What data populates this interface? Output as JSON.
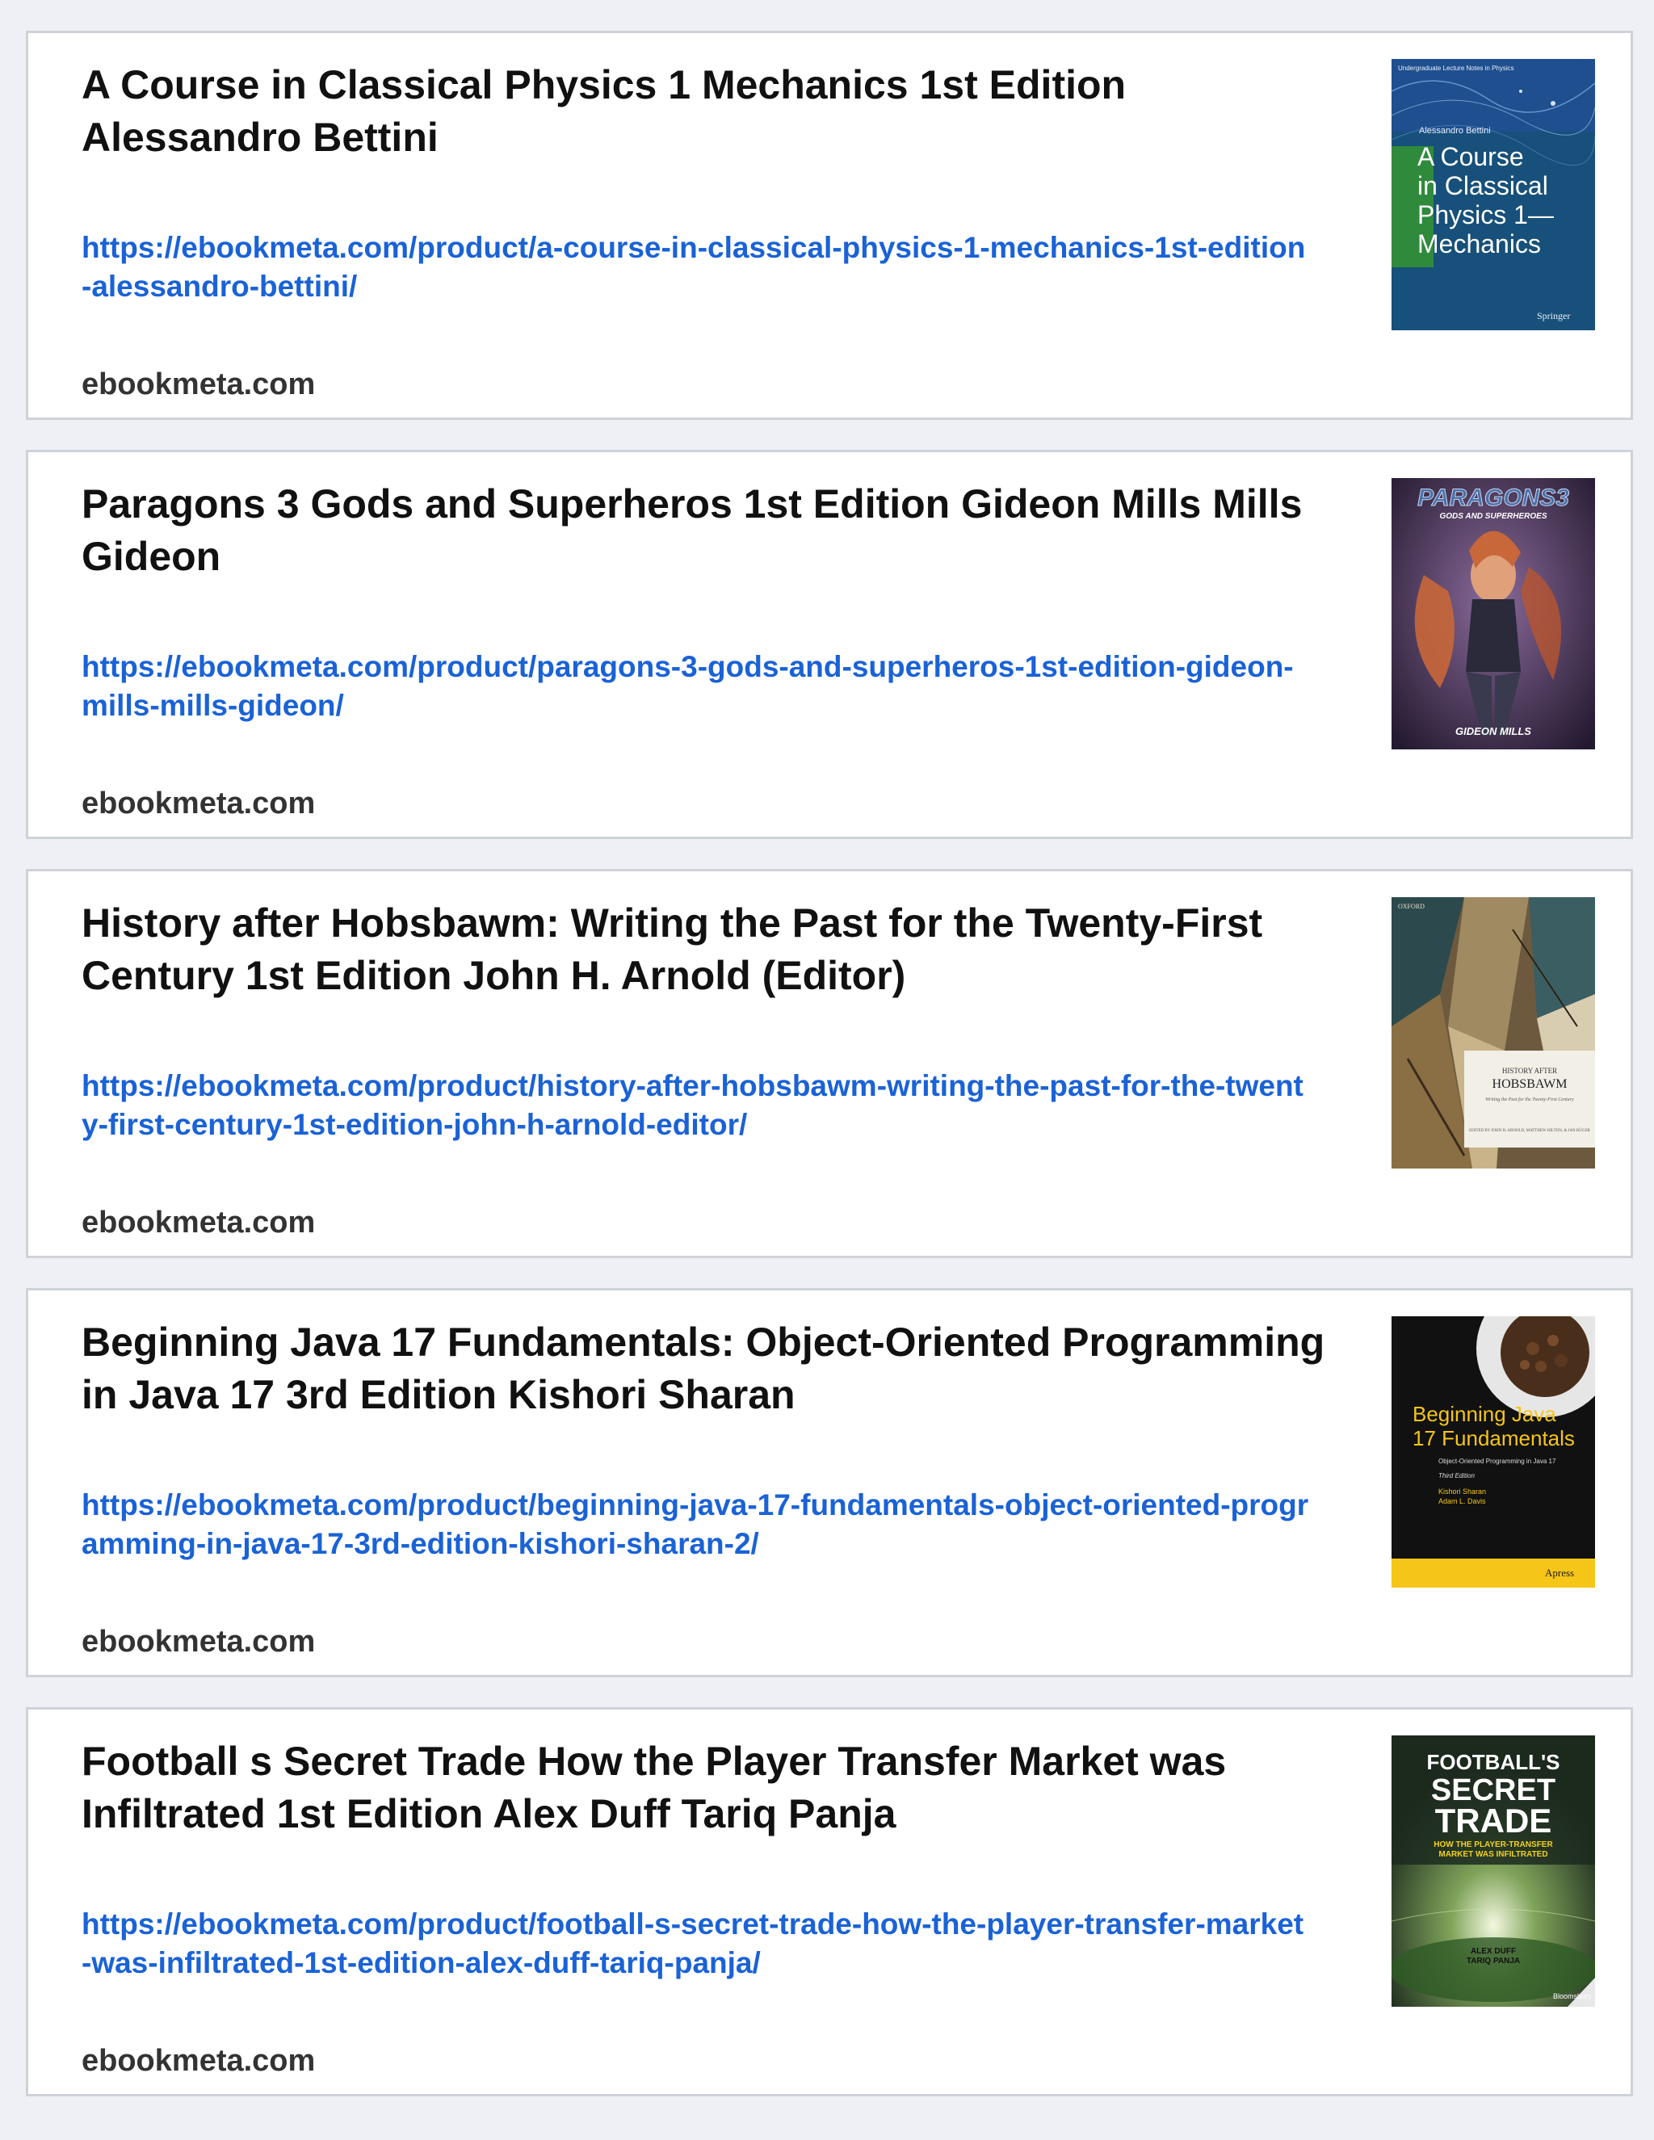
{
  "results": [
    {
      "title": "A Course in Classical Physics 1 Mechanics 1st Edition Alessandro Bettini",
      "url": "https://ebookmeta.com/product/a-course-in-classical-physics-1-mechanics-1st-edition-alessandro-bettini/",
      "domain": "ebookmeta.com",
      "cover": {
        "series": "Undergraduate Lecture Notes in Physics",
        "author": "Alessandro Bettini",
        "title_lines": [
          "A Course",
          "in Classical",
          "Physics 1—",
          "Mechanics"
        ],
        "publisher": "Springer",
        "bg_color": "#17507a",
        "accent_color": "#2f8a3c"
      }
    },
    {
      "title": "Paragons 3 Gods and Superheros 1st Edition Gideon Mills Mills Gideon",
      "url": "https://ebookmeta.com/product/paragons-3-gods-and-superheros-1st-edition-gideon-mills-mills-gideon/",
      "domain": "ebookmeta.com",
      "cover": {
        "title": "PARAGONS3",
        "subtitle": "GODS AND SUPERHEROES",
        "author": "GIDEON MILLS",
        "bg_color": "#3a2f4a",
        "accent_color": "#c8673a"
      }
    },
    {
      "title": "History after Hobsbawm: Writing the Past for the Twenty-First Century 1st Edition John H. Arnold (Editor)",
      "url": "https://ebookmeta.com/product/history-after-hobsbawm-writing-the-past-for-the-twenty-first-century-1st-edition-john-h-arnold-editor/",
      "domain": "ebookmeta.com",
      "cover": {
        "publisher": "OXFORD",
        "kicker": "HISTORY AFTER",
        "title": "HOBSBAWM",
        "subtitle": "Writing the Past for the Twenty-First Century",
        "editors": "EDITED BY JOHN H. ARNOLD, MATTHEW HILTON, & JAN RÜGER",
        "bg_color": "#6d5a3e",
        "accent_color": "#2c4a4e"
      }
    },
    {
      "title": "Beginning Java 17 Fundamentals: Object-Oriented Programming in Java 17 3rd Edition Kishori Sharan",
      "url": "https://ebookmeta.com/product/beginning-java-17-fundamentals-object-oriented-programming-in-java-17-3rd-edition-kishori-sharan-2/",
      "domain": "ebookmeta.com",
      "cover": {
        "title_lines": [
          "Beginning Java",
          "17 Fundamentals"
        ],
        "subtitle": "Object-Oriented Programming in Java 17",
        "edition": "Third Edition",
        "authors": [
          "Kishori Sharan",
          "Adam L. Davis"
        ],
        "publisher": "Apress",
        "bg_color": "#111111",
        "accent_color": "#f5c518"
      }
    },
    {
      "title": "Football s Secret Trade How the Player Transfer Market was Infiltrated 1st Edition Alex Duff Tariq Panja",
      "url": "https://ebookmeta.com/product/football-s-secret-trade-how-the-player-transfer-market-was-infiltrated-1st-edition-alex-duff-tariq-panja/",
      "domain": "ebookmeta.com",
      "cover": {
        "title_lines": [
          "FOOTBALL'S",
          "SECRET",
          "TRADE"
        ],
        "subtitle_lines": [
          "HOW THE PLAYER-TRANSFER",
          "MARKET WAS INFILTRATED"
        ],
        "authors": [
          "ALEX DUFF",
          "TARIQ PANJA"
        ],
        "publisher": "Bloomsbury",
        "bg_color": "#1c2a1e",
        "accent_color": "#f2d21c"
      }
    }
  ]
}
